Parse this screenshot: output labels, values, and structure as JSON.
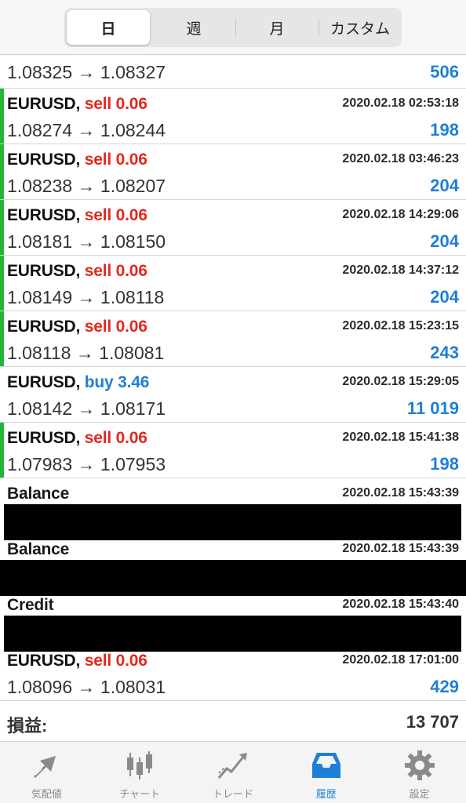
{
  "periods": {
    "items": [
      "日",
      "週",
      "月",
      "カスタム"
    ],
    "active": "日"
  },
  "first_row": {
    "prices": "1.08325 → 1.08327",
    "value": "506"
  },
  "trades": [
    {
      "symbol": "EURUSD,",
      "side": "sell",
      "side_label": "sell 0.06",
      "time": "2020.02.18 02:53:18",
      "prices": "1.08274 → 1.08244",
      "value": "198"
    },
    {
      "symbol": "EURUSD,",
      "side": "sell",
      "side_label": "sell 0.06",
      "time": "2020.02.18 03:46:23",
      "prices": "1.08238 → 1.08207",
      "value": "204"
    },
    {
      "symbol": "EURUSD,",
      "side": "sell",
      "side_label": "sell 0.06",
      "time": "2020.02.18 14:29:06",
      "prices": "1.08181 → 1.08150",
      "value": "204"
    },
    {
      "symbol": "EURUSD,",
      "side": "sell",
      "side_label": "sell 0.06",
      "time": "2020.02.18 14:37:12",
      "prices": "1.08149 → 1.08118",
      "value": "204"
    },
    {
      "symbol": "EURUSD,",
      "side": "sell",
      "side_label": "sell 0.06",
      "time": "2020.02.18 15:23:15",
      "prices": "1.08118 → 1.08081",
      "value": "243"
    },
    {
      "symbol": "EURUSD,",
      "side": "buy",
      "side_label": "buy 3.46",
      "time": "2020.02.18 15:29:05",
      "prices": "1.08142 → 1.08171",
      "value": "11 019"
    },
    {
      "symbol": "EURUSD,",
      "side": "sell",
      "side_label": "sell 0.06",
      "time": "2020.02.18 15:41:38",
      "prices": "1.07983 → 1.07953",
      "value": "198"
    }
  ],
  "balance_ops": [
    {
      "label": "Balance",
      "time": "2020.02.18 15:43:39"
    },
    {
      "label": "Balance",
      "time": "2020.02.18 15:43:39"
    },
    {
      "label": "Credit",
      "time": "2020.02.18 15:43:40"
    }
  ],
  "last_trade": {
    "symbol": "EURUSD,",
    "side": "sell",
    "side_label": "sell 0.06",
    "time": "2020.02.18 17:01:00",
    "prices": "1.08096 → 1.08031",
    "value": "429"
  },
  "summary": {
    "label": "損益:",
    "value": "13 707"
  },
  "tabs": [
    {
      "label": "気配値",
      "icon": "quotes-icon"
    },
    {
      "label": "チャート",
      "icon": "chart-icon"
    },
    {
      "label": "トレード",
      "icon": "trade-icon"
    },
    {
      "label": "履歴",
      "icon": "history-icon",
      "active": true
    },
    {
      "label": "設定",
      "icon": "settings-icon"
    }
  ],
  "colors": {
    "sell": "#e0291f",
    "buy": "#1f7fd6",
    "accent": "#1f7fd6",
    "bar": "#27b43a"
  }
}
